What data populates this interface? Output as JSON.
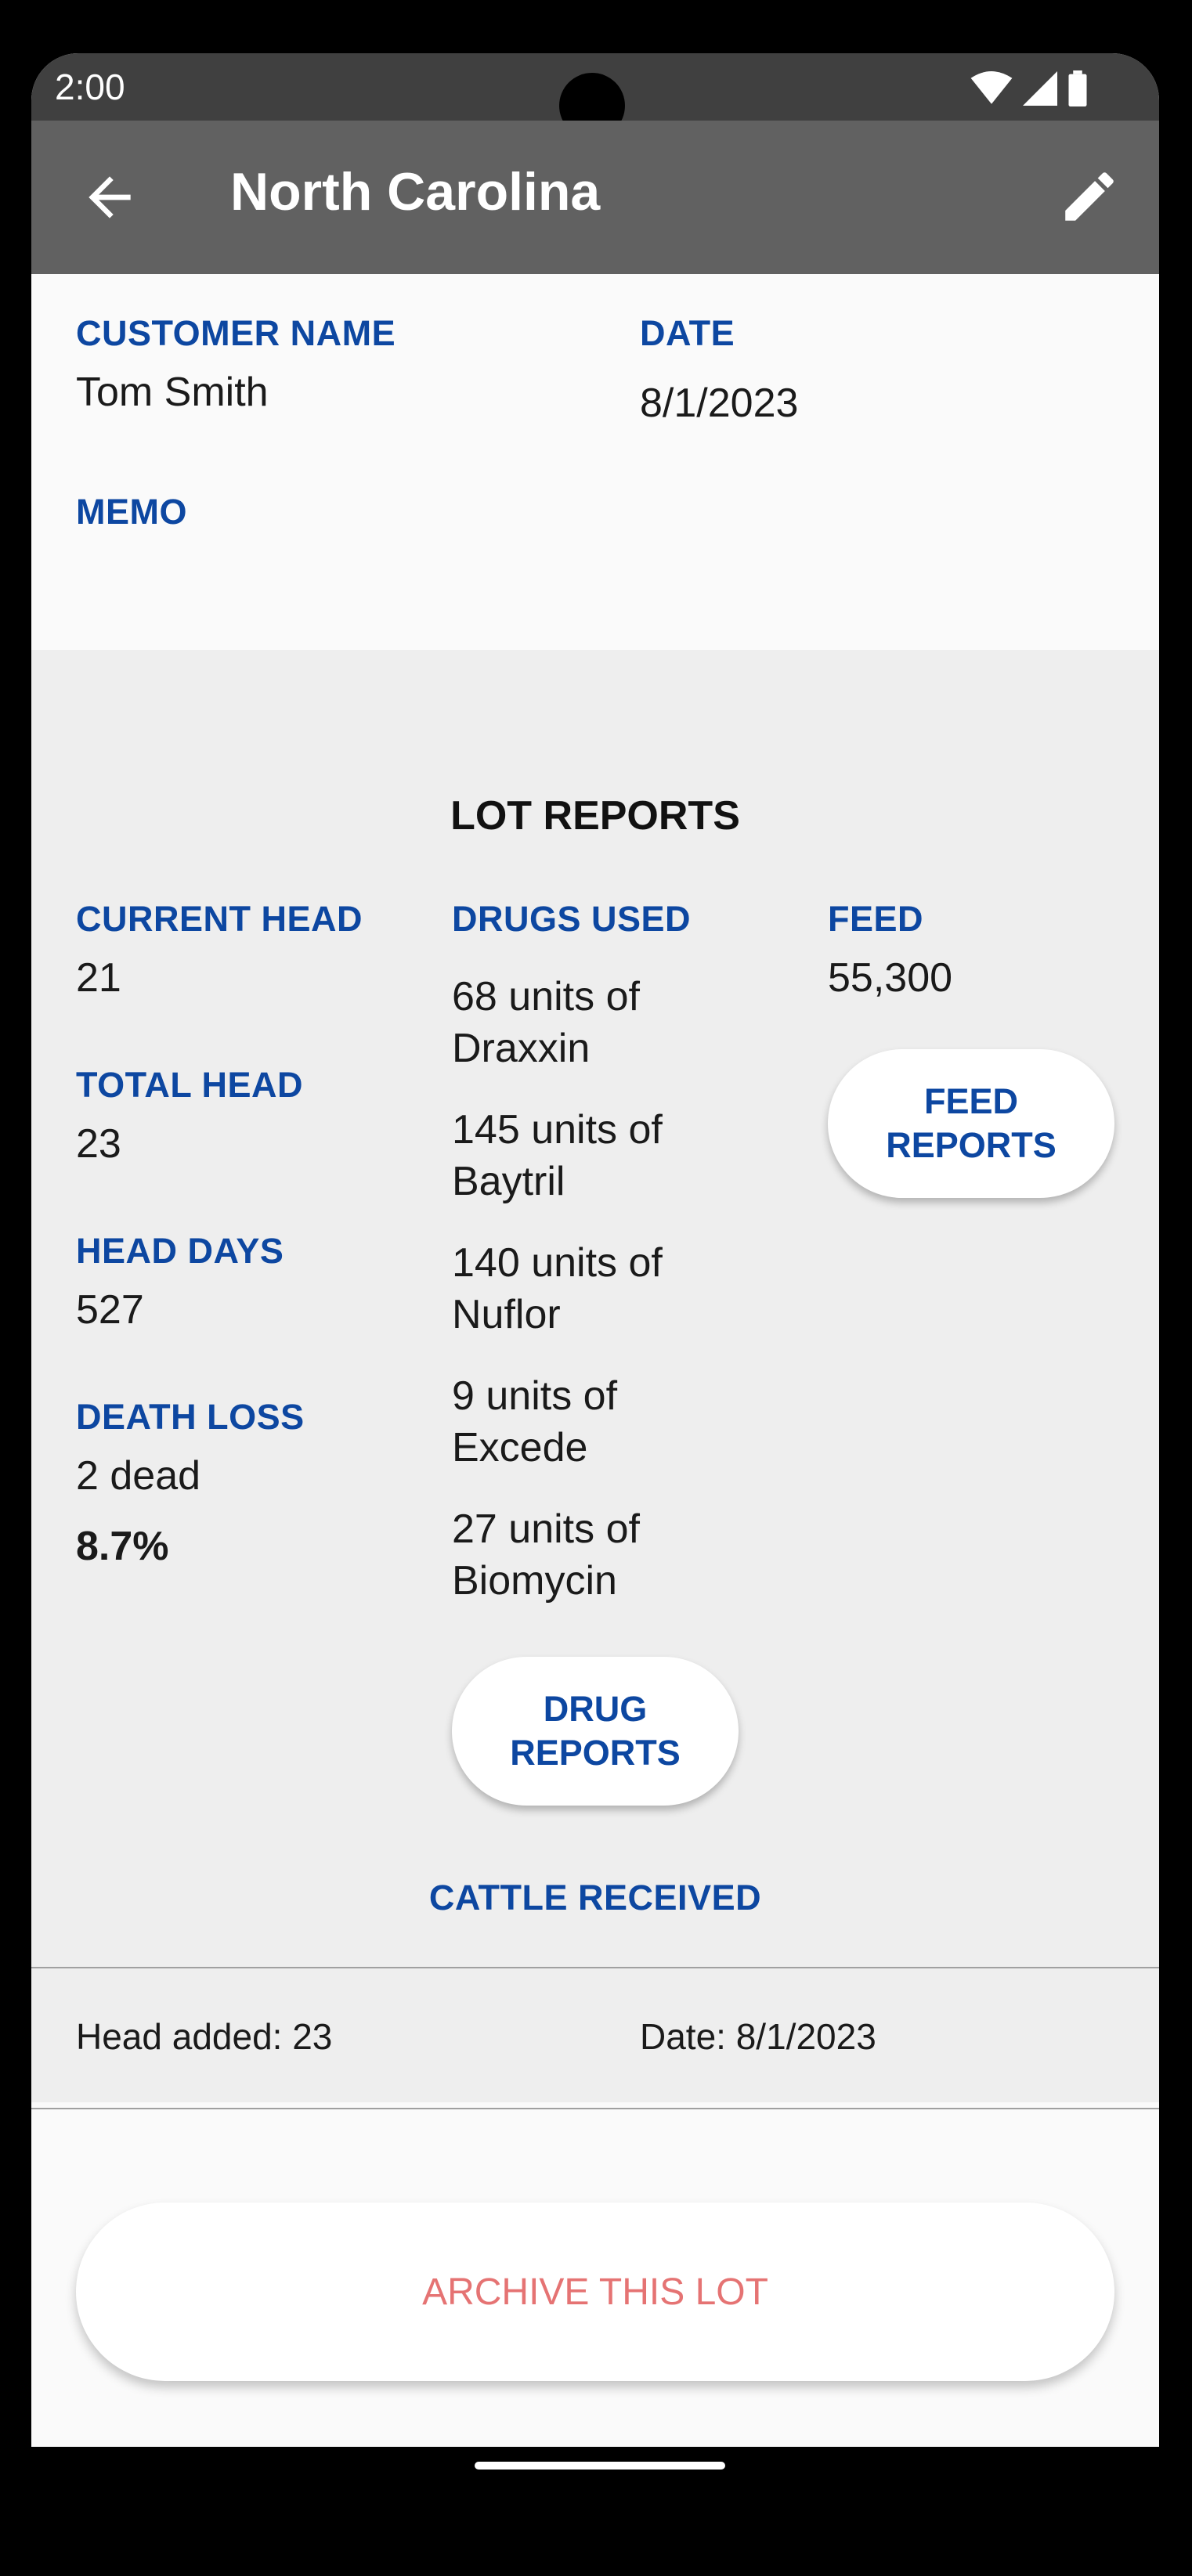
{
  "status_bar": {
    "time": "2:00"
  },
  "app_bar": {
    "title": "North Carolina"
  },
  "header": {
    "customer_label": "CUSTOMER NAME",
    "customer_value": "Tom Smith",
    "date_label": "DATE",
    "date_value": "8/1/2023",
    "memo_label": "MEMO"
  },
  "lot_reports": {
    "title": "LOT REPORTS",
    "current_head_label": "CURRENT HEAD",
    "current_head_value": "21",
    "total_head_label": "TOTAL HEAD",
    "total_head_value": "23",
    "head_days_label": "HEAD DAYS",
    "head_days_value": "527",
    "death_loss_label": "DEATH LOSS",
    "death_loss_value": "2 dead",
    "death_loss_percent": "8.7%",
    "drugs_label": "DRUGS USED",
    "drugs": [
      {
        "line1": "68 units of",
        "line2": "Draxxin"
      },
      {
        "line1": "145 units of",
        "line2": "Baytril"
      },
      {
        "line1": "140 units of",
        "line2": "Nuflor"
      },
      {
        "line1": "9 units of",
        "line2": "Excede"
      },
      {
        "line1": "27 units of",
        "line2": "Biomycin"
      }
    ],
    "drug_reports_line1": "DRUG",
    "drug_reports_line2": "REPORTS",
    "feed_label": "FEED",
    "feed_value": "55,300",
    "feed_reports_line1": "FEED",
    "feed_reports_line2": "REPORTS",
    "cattle_received_label": "CATTLE RECEIVED"
  },
  "cattle_received": {
    "head_added": "Head added: 23",
    "date": "Date: 8/1/2023"
  },
  "archive_button": "ARCHIVE THIS LOT",
  "colors": {
    "label_blue": "#0d47a1",
    "app_bar": "#616161",
    "status_bar": "#404040",
    "archive_text": "#e57373",
    "section_bg": "#eeeeee"
  },
  "icons": [
    "back-arrow-icon",
    "edit-pencil-icon",
    "wifi-icon",
    "signal-icon",
    "battery-icon"
  ]
}
